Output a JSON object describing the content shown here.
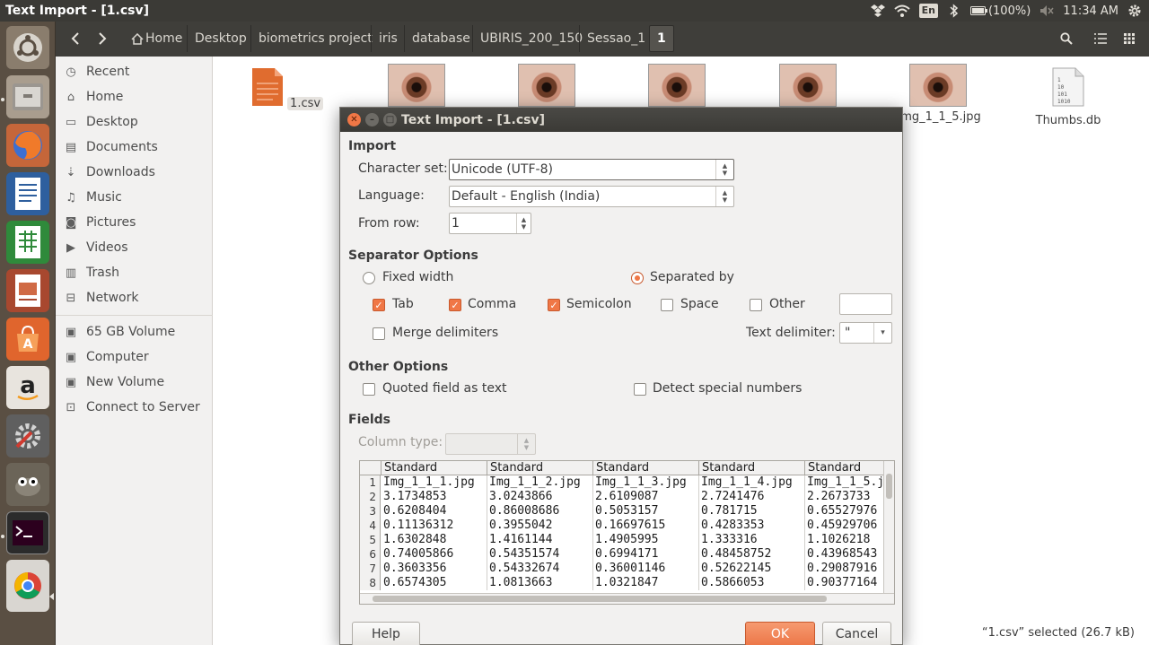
{
  "window_title": "Text Import - [1.csv]",
  "indicators": {
    "keyboard": "En",
    "battery": "(100%)",
    "time": "11:34 AM"
  },
  "breadcrumbs": [
    "Home",
    "Desktop",
    "biometrics project",
    "iris",
    "database",
    "UBIRIS_200_150",
    "Sessao_1",
    "1"
  ],
  "sidebar": {
    "places": [
      {
        "label": "Recent",
        "icon": "clock-icon"
      },
      {
        "label": "Home",
        "icon": "home-icon"
      },
      {
        "label": "Desktop",
        "icon": "desktop-icon"
      },
      {
        "label": "Documents",
        "icon": "documents-icon"
      },
      {
        "label": "Downloads",
        "icon": "download-icon"
      },
      {
        "label": "Music",
        "icon": "music-icon"
      },
      {
        "label": "Pictures",
        "icon": "camera-icon"
      },
      {
        "label": "Videos",
        "icon": "video-icon"
      },
      {
        "label": "Trash",
        "icon": "trash-icon"
      },
      {
        "label": "Network",
        "icon": "network-icon"
      }
    ],
    "devices": [
      {
        "label": "65 GB Volume",
        "icon": "drive-icon"
      },
      {
        "label": "Computer",
        "icon": "drive-icon"
      },
      {
        "label": "New Volume",
        "icon": "drive-icon"
      },
      {
        "label": "Connect to Server",
        "icon": "server-icon"
      }
    ]
  },
  "files": [
    {
      "name": "1.csv",
      "type": "csv"
    },
    {
      "name": "",
      "type": "eye"
    },
    {
      "name": "",
      "type": "eye"
    },
    {
      "name": "",
      "type": "eye"
    },
    {
      "name": "",
      "type": "eye"
    },
    {
      "name": "mg_1_1_5.jpg",
      "type": "eye"
    },
    {
      "name": "Thumbs.db",
      "type": "db"
    }
  ],
  "status": "“1.csv” selected  (26.7 kB)",
  "dialog": {
    "title": "Text Import - [1.csv]",
    "import_title": "Import",
    "charset_label": "Character set:",
    "charset_value": "Unicode (UTF-8)",
    "language_label": "Language:",
    "language_value": "Default - English (India)",
    "fromrow_label": "From row:",
    "fromrow_value": "1",
    "separator_title": "Separator Options",
    "fixed_width": "Fixed width",
    "separated_by": "Separated by",
    "tab": "Tab",
    "comma": "Comma",
    "semicolon": "Semicolon",
    "space": "Space",
    "other": "Other",
    "merge_delimiters": "Merge delimiters",
    "text_delimiter_label": "Text delimiter:",
    "text_delimiter_value": "\"",
    "other_options_title": "Other Options",
    "quoted_field": "Quoted field as text",
    "detect_special": "Detect special numbers",
    "fields_title": "Fields",
    "column_type_label": "Column type:",
    "help": "Help",
    "ok": "OK",
    "cancel": "Cancel"
  },
  "preview": {
    "headers": [
      "Standard",
      "Standard",
      "Standard",
      "Standard",
      "Standard"
    ],
    "rows": [
      {
        "n": "1",
        "cells": [
          "Img_1_1_1.jpg",
          "Img_1_1_2.jpg",
          "Img_1_1_3.jpg",
          "Img_1_1_4.jpg",
          "Img_1_1_5.j"
        ]
      },
      {
        "n": "2",
        "cells": [
          "3.1734853",
          "3.0243866",
          "2.6109087",
          "2.7241476",
          "2.2673733"
        ]
      },
      {
        "n": "3",
        "cells": [
          "0.6208404",
          "0.86008686",
          "0.5053157",
          "0.781715",
          "0.65527976"
        ]
      },
      {
        "n": "4",
        "cells": [
          "0.11136312",
          "0.3955042",
          "0.16697615",
          "0.4283353",
          "0.45929706"
        ]
      },
      {
        "n": "5",
        "cells": [
          "1.6302848",
          "1.4161144",
          "1.4905995",
          "1.333316",
          "1.1026218"
        ]
      },
      {
        "n": "6",
        "cells": [
          "0.74005866",
          "0.54351574",
          "0.6994171",
          "0.48458752",
          "0.43968543"
        ]
      },
      {
        "n": "7",
        "cells": [
          "0.3603356",
          "0.54332674",
          "0.36001146",
          "0.52622145",
          "0.29087916"
        ]
      },
      {
        "n": "8",
        "cells": [
          "0.6574305",
          "1.0813663",
          "1.0321847",
          "0.5866053",
          "0.90377164"
        ]
      }
    ]
  },
  "colors": {
    "accent": "#f07746",
    "panel": "#3b3a36",
    "launcher": "#5a4f43"
  }
}
